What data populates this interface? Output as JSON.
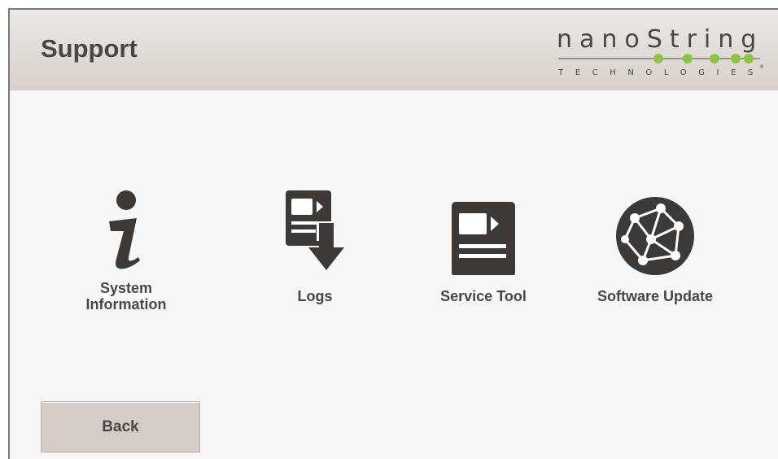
{
  "header": {
    "title": "Support",
    "logo": {
      "brand": "nanoString",
      "tagline": "TECHNOLOGIES",
      "accent_color": "#8cc63f"
    }
  },
  "tiles": [
    {
      "label_line1": "System",
      "label_line2": "Information",
      "icon": "info-icon"
    },
    {
      "label": "Logs",
      "icon": "logs-download-icon"
    },
    {
      "label": "Service Tool",
      "icon": "service-tool-icon"
    },
    {
      "label": "Software Update",
      "icon": "globe-network-icon"
    }
  ],
  "footer": {
    "back_label": "Back"
  },
  "colors": {
    "icon": "#3d3937",
    "text": "#4a4644",
    "header_top": "#ece9e6",
    "header_bottom": "#d9d0c9",
    "button": "#d6ccc6"
  }
}
